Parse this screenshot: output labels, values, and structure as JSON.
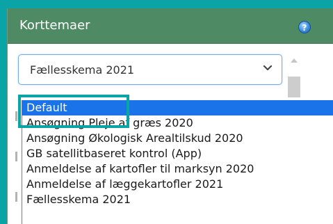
{
  "panel": {
    "title": "Korttemaer",
    "help_icon_glyph": "?",
    "colors": {
      "frame": "#0aa3a6",
      "header": "#4e8a64",
      "selected": "#1a73e8"
    }
  },
  "select": {
    "value": "Fællesskema 2021",
    "options": [
      "Default",
      "Ansøgning Pleje af græs 2020",
      "Ansøgning Økologisk Arealtilskud 2020",
      "GB satellitbaseret kontrol (App)",
      "Anmeldelse af kartofler til marksyn 2020",
      "Anmeldelse af læggekartofler 2021",
      "Fællesskema 2021"
    ],
    "highlighted_index": 0
  }
}
